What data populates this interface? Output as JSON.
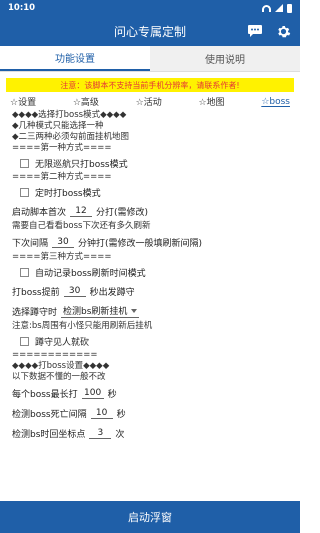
{
  "status": {
    "time": "10:10"
  },
  "app": {
    "title": "问心专属定制"
  },
  "icons": {
    "chat": "chat-bubble-icon",
    "settings": "gear-icon"
  },
  "tabs": [
    "功能设置",
    "使用说明"
  ],
  "notice": "注意：该脚本不支持当前手机分辨率，请联系作者!",
  "subtabs": [
    "☆设置",
    "☆高级",
    "☆活动",
    "☆地图",
    "☆boss"
  ],
  "boss": {
    "intro1": "◆◆◆◆选择打boss模式◆◆◆◆",
    "intro2": "◆几种模式只能选择一种",
    "intro3": "◆二三两种必须勾前面挂机地图",
    "sec1": "====第一种方式====",
    "mode1_label": "无限巡航只打boss模式",
    "sec2": "====第二种方式====",
    "mode2_label": "定时打boss模式",
    "first_prefix": "启动脚本首次",
    "first_value": "12",
    "first_suffix": "分打(需修改)",
    "note1": "需要自己看看boss下次还有多久刷新",
    "interval_prefix": "下次间隔",
    "interval_value": "30",
    "interval_suffix": "分钟打(需修改一般填刷新间隔)",
    "sec3": "====第三种方式====",
    "mode3_label": "自动记录boss刷新时间模式",
    "early_prefix": "打boss提前",
    "early_value": "30",
    "early_suffix": "秒出发蹲守",
    "squat_prefix": "选择蹲守时",
    "squat_selected": "检测bs刷新挂机",
    "note2": "注意:bs周围有小怪只能用刷新后挂机",
    "squat_defeat_label": "蹲守见人就砍",
    "sec4": "============",
    "settings_title": "◆◆◆◆打boss设置◆◆◆◆",
    "note3": "以下数据不懂的一般不改",
    "max_prefix": "每个boss最长打",
    "max_value": "100",
    "max_suffix": "秒",
    "death_prefix": "检测boss死亡间隔",
    "death_value": "10",
    "death_suffix": "秒",
    "return_prefix": "检测bs时回坐标点",
    "return_value": "3",
    "return_suffix": "次"
  },
  "bottom_button": "启动浮窗",
  "colors": {
    "primary": "#1f5fa8",
    "notice_bg": "#fff200",
    "notice_text": "#e53935"
  }
}
